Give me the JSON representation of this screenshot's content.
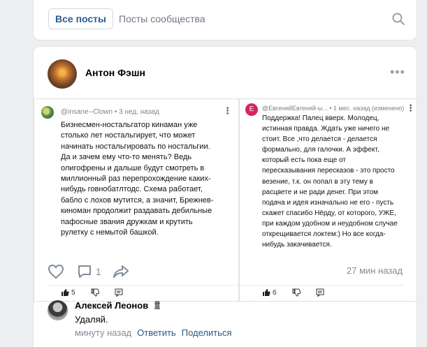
{
  "tabs": {
    "all_posts": "Все посты",
    "community_posts": "Посты сообщества"
  },
  "post": {
    "author": "Антон Фэшн",
    "more": "•••",
    "comments_count": "1",
    "time": "27 мин назад"
  },
  "screenshot_left": {
    "meta": "@insane--Clown • 3 нед. назад",
    "lines": [
      "Бизнесмен-ностальгатор кинаман уже",
      "столько лет ностальгирует, что может",
      "начинать ностальгировать по ностальгии.",
      "Да и зачем ему что-то менять? Ведь",
      "олигофрены и дальше будут смотреть в",
      "миллионный раз перепрохождение каких-",
      "нибудь говнобатлтодс. Схема работает,",
      "бабло с лохов мутится, а значит, Брежнев-",
      "киноман продолжит раздавать дебильные",
      "пафосные звания дружкам и крутить",
      "рулетку с немытой башкой."
    ],
    "likes": "5"
  },
  "screenshot_right": {
    "avatar_letter": "E",
    "meta": "@ЕвгенийЕвгений-ы... • 1 мес. назад (изменено)",
    "lines": [
      "Поддержка!  Палец  вверх. Молодец,",
      "истинная  правда. Ждать уже ничего  не",
      "стоит. Все ,что делается - делается",
      "формально, для галочки. А эффект,",
      "который  есть пока еще  от",
      "пересказывания пересказов  - это просто",
      "везение,  т.к. он    попал  в эту  тему  в",
      "расцвете  и  не  ради  денег.  При этом",
      "подача  и идея  изначально не его - пусть",
      "скажет спасибо Нёрду, от которого, УЖЕ,",
      "при каждом  удобном  и неудобном случае",
      "открещивается локтем:)   Но все когда-",
      "нибудь закачивается."
    ],
    "likes": "6"
  },
  "comment": {
    "author": "Алексей Леонов",
    "text": "Удаляй.",
    "time": "минуту назад",
    "reply": "Ответить",
    "share": "Поделиться"
  },
  "colors": {
    "accent": "#2a5885",
    "muted": "#818c99",
    "right_avatar": "#d6245a"
  }
}
